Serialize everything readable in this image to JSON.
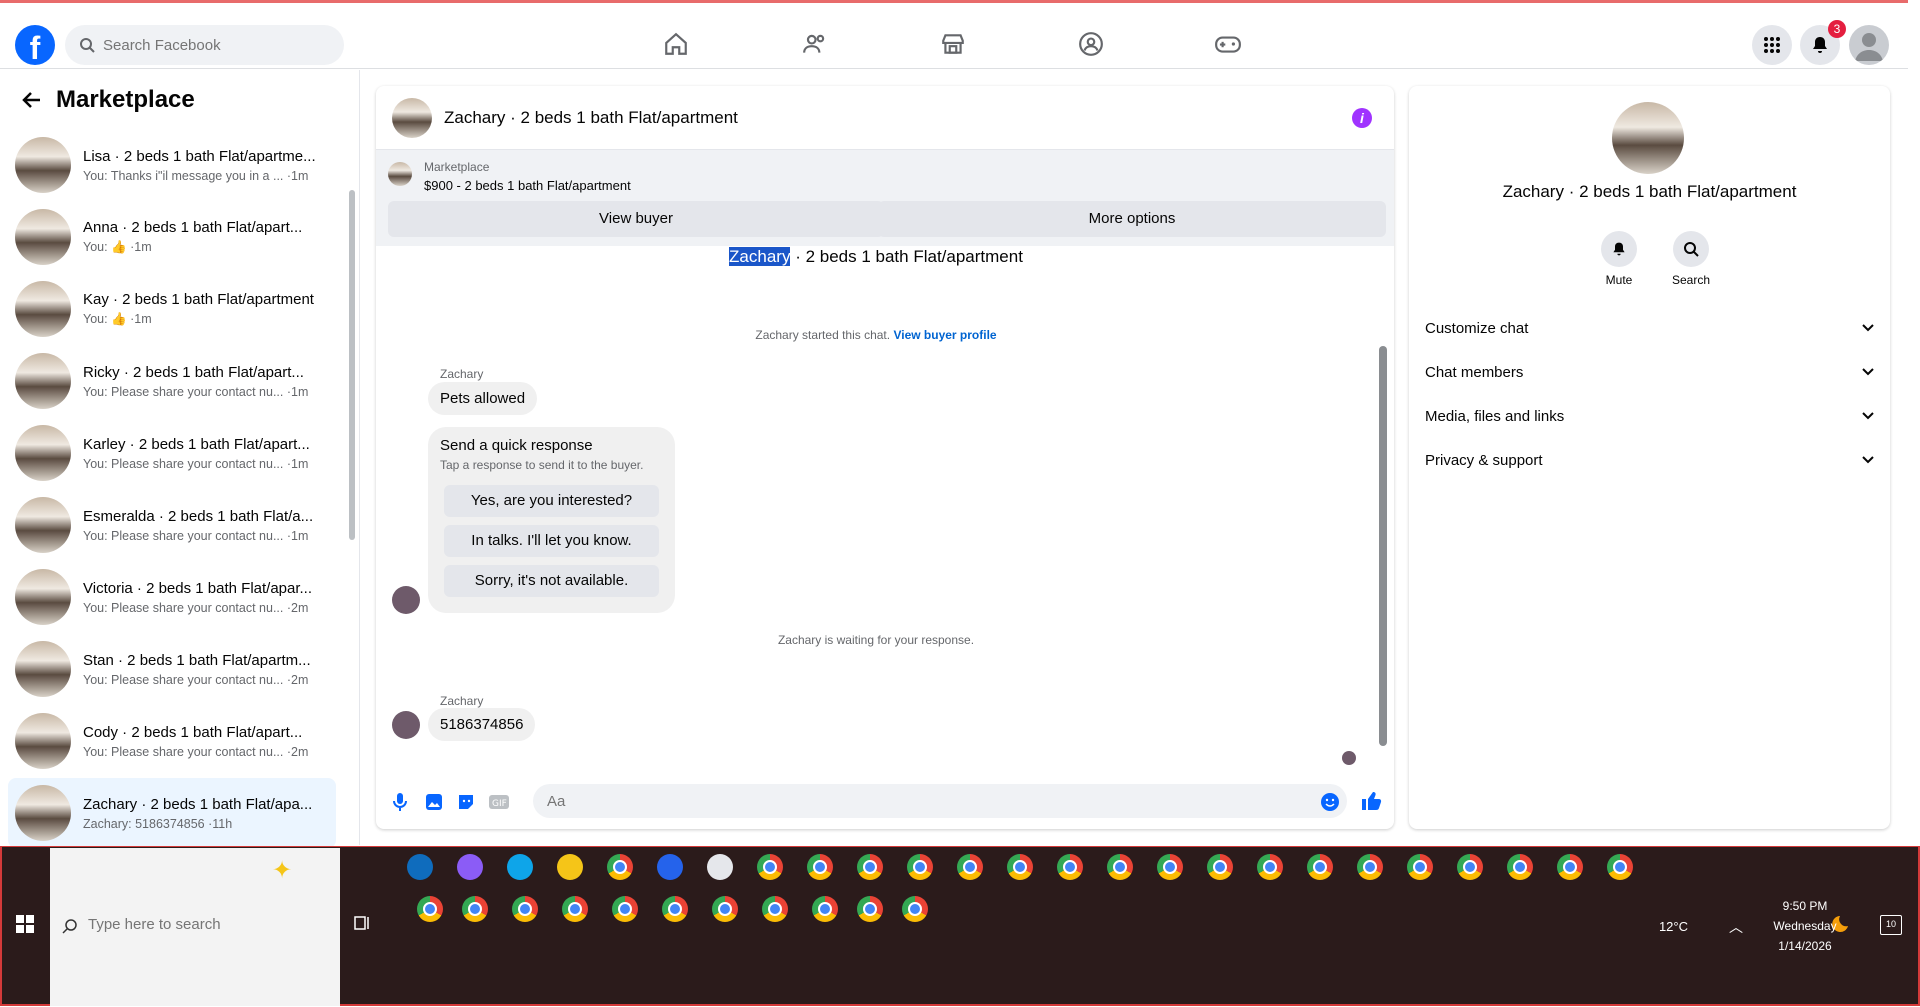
{
  "topbar": {
    "search_placeholder": "Search Facebook",
    "notification_count": "3"
  },
  "sidebar": {
    "title": "Marketplace",
    "conversations": [
      {
        "name": "Lisa · 2 beds 1 bath Flat/apartme...",
        "preview": "You: Thanks i\"il message you in a ...",
        "time": "·1m"
      },
      {
        "name": "Anna · 2 beds 1 bath Flat/apart...",
        "preview": "You:",
        "time": "·1m",
        "thumbs_up": true
      },
      {
        "name": "Kay · 2 beds 1 bath Flat/apartment",
        "preview": "You:",
        "time": "·1m",
        "thumbs_up": true
      },
      {
        "name": "Ricky · 2 beds 1 bath Flat/apart...",
        "preview": "You: Please share your contact nu...",
        "time": "·1m"
      },
      {
        "name": "Karley · 2 beds 1 bath Flat/apart...",
        "preview": "You: Please share your contact nu...",
        "time": "·1m"
      },
      {
        "name": "Esmeralda · 2 beds 1 bath Flat/a...",
        "preview": "You: Please share your contact nu...",
        "time": "·1m"
      },
      {
        "name": "Victoria · 2 beds 1 bath Flat/apar...",
        "preview": "You: Please share your contact nu...",
        "time": "·2m"
      },
      {
        "name": "Stan · 2 beds 1 bath Flat/apartm...",
        "preview": "You: Please share your contact nu...",
        "time": "·2m"
      },
      {
        "name": "Cody · 2 beds 1 bath Flat/apart...",
        "preview": "You: Please share your contact nu...",
        "time": "·2m"
      },
      {
        "name": "Zachary · 2 beds 1 bath Flat/apa...",
        "preview": "Zachary: 5186374856",
        "time": "·11h",
        "active": true
      }
    ]
  },
  "chat": {
    "header_title": "Zachary · 2 beds 1 bath Flat/apartment",
    "marketplace_label": "Marketplace",
    "listing_price": "$900 - 2 beds 1 bath Flat/apartment",
    "view_buyer": "View buyer",
    "more_options": "More options",
    "top_name_highlight": "Zachary",
    "top_name_rest": " · 2 beds 1 bath Flat/apartment",
    "start_note": "Zachary started this chat.",
    "start_link": "View buyer profile",
    "sender": "Zachary",
    "msg1": "Pets allowed",
    "quick_title": "Send a quick response",
    "quick_sub": "Tap a response to send it to the buyer.",
    "quick_options": [
      "Yes, are you interested?",
      "In talks. I'll let you know.",
      "Sorry, it's not available."
    ],
    "wait_note": "Zachary is waiting for your response.",
    "msg2": "5186374856",
    "input_placeholder": "Aa"
  },
  "info_panel": {
    "name": "Zachary · 2 beds 1 bath Flat/apartment",
    "mute": "Mute",
    "search": "Search",
    "sections": [
      "Customize chat",
      "Chat members",
      "Media, files and links",
      "Privacy & support"
    ]
  },
  "taskbar": {
    "search_placeholder": "Type here to search",
    "weather": "12°C",
    "time": "9:50 PM",
    "day": "Wednesday",
    "date": "1/14/2026",
    "notif_count": "10"
  },
  "colors": {
    "fb_blue": "#0866ff",
    "active_row": "#ebf5ff",
    "info_purple": "#a033ff",
    "badge_red": "#e41e3f"
  }
}
